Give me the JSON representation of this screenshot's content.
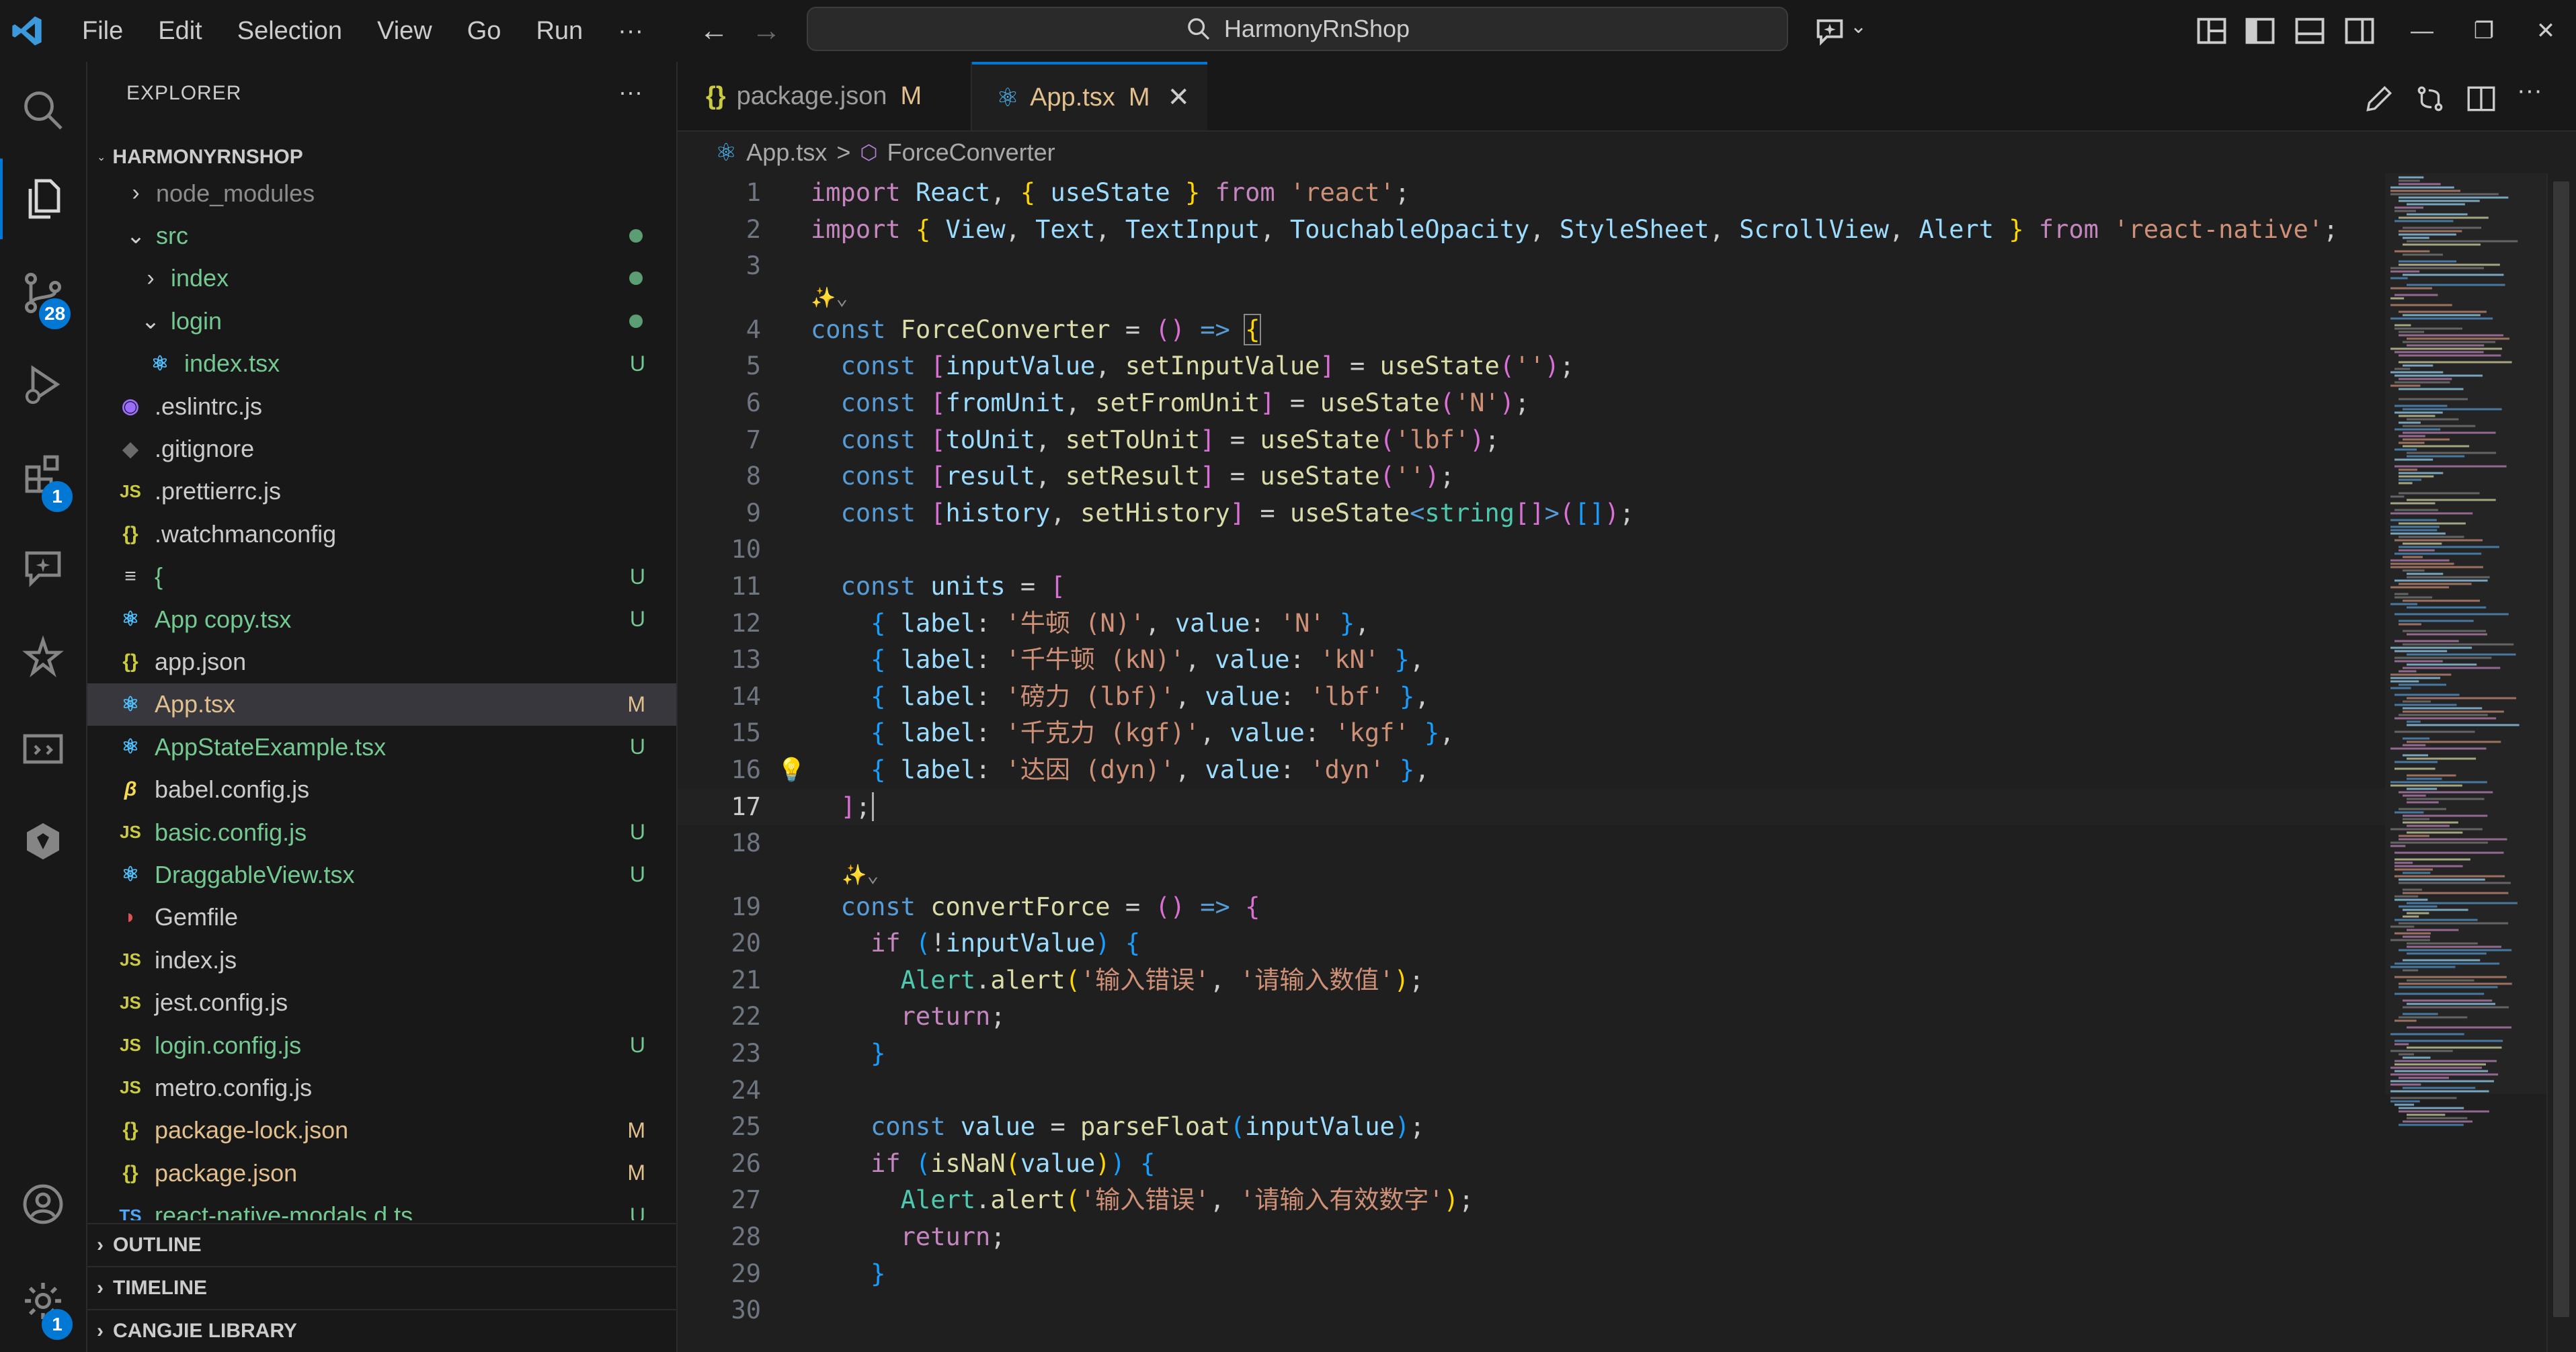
{
  "titlebar": {
    "menu": [
      "File",
      "Edit",
      "Selection",
      "View",
      "Go",
      "Run",
      "···"
    ],
    "search": "HarmonyRnShop"
  },
  "activity": {
    "scm_badge": "28",
    "extensions_badge": "1",
    "settings_badge": "1"
  },
  "sidebar": {
    "title": "EXPLORER",
    "more": "···",
    "root": "HARMONYRNSHOP",
    "items": [
      {
        "label": "node_modules",
        "icon": "chevron-right"
      },
      {
        "label": "src",
        "icon": "chevron-down"
      },
      {
        "label": "index",
        "icon": "chevron-right"
      },
      {
        "label": "login",
        "icon": "chevron-down"
      },
      {
        "label": "index.tsx",
        "icon": "react-icon",
        "status": "U"
      },
      {
        "label": ".eslintrc.js",
        "icon": "eslint-icon"
      },
      {
        "label": ".gitignore",
        "icon": "git-icon"
      },
      {
        "label": ".prettierrc.js",
        "icon": "js-icon",
        "icon_text": "JS"
      },
      {
        "label": ".watchmanconfig",
        "icon": "json-icon",
        "icon_text": "{}"
      },
      {
        "label": "{",
        "icon": "text-file-icon",
        "icon_text": "≡",
        "status": "U"
      },
      {
        "label": "App copy.tsx",
        "icon": "react-icon",
        "status": "U"
      },
      {
        "label": "app.json",
        "icon": "json-icon",
        "icon_text": "{}"
      },
      {
        "label": "App.tsx",
        "icon": "react-icon",
        "status": "M"
      },
      {
        "label": "AppStateExample.tsx",
        "icon": "react-icon",
        "status": "U"
      },
      {
        "label": "babel.config.js",
        "icon": "babel-icon",
        "icon_text": "β"
      },
      {
        "label": "basic.config.js",
        "icon": "js-icon",
        "icon_text": "JS",
        "status": "U"
      },
      {
        "label": "DraggableView.tsx",
        "icon": "react-icon",
        "status": "U"
      },
      {
        "label": "Gemfile",
        "icon": "ruby-icon"
      },
      {
        "label": "index.js",
        "icon": "js-icon",
        "icon_text": "JS"
      },
      {
        "label": "jest.config.js",
        "icon": "js-icon",
        "icon_text": "JS"
      },
      {
        "label": "login.config.js",
        "icon": "js-icon",
        "icon_text": "JS",
        "status": "U"
      },
      {
        "label": "metro.config.js",
        "icon": "js-icon",
        "icon_text": "JS"
      },
      {
        "label": "package-lock.json",
        "icon": "json-icon",
        "icon_text": "{}",
        "status": "M"
      },
      {
        "label": "package.json",
        "icon": "json-icon",
        "icon_text": "{}",
        "status": "M"
      },
      {
        "label": "react-native-modals.d.ts",
        "icon": "ts-icon",
        "icon_text": "TS",
        "status": "U"
      }
    ],
    "sections": [
      "OUTLINE",
      "TIMELINE",
      "CANGJIE LIBRARY"
    ]
  },
  "tabs": [
    {
      "label": "package.json",
      "icon_text": "{}",
      "status": "M"
    },
    {
      "label": "App.tsx",
      "status": "M",
      "close": "✕"
    }
  ],
  "breadcrumb": {
    "file": "App.tsx",
    "sep": ">",
    "symbol": "ForceConverter"
  },
  "editor": {
    "current_line": 17,
    "line_numbers": [
      "1",
      "2",
      "3",
      "4",
      "5",
      "6",
      "7",
      "8",
      "9",
      "10",
      "11",
      "12",
      "13",
      "14",
      "15",
      "16",
      "17",
      "18",
      "19",
      "20",
      "21",
      "22",
      "23",
      "24",
      "25",
      "26",
      "27",
      "28",
      "29",
      "30"
    ],
    "code": [
      "import React, { useState } from 'react';",
      "import { View, Text, TextInput, TouchableOpacity, StyleSheet, ScrollView, Alert } from 'react-native';",
      "",
      "const ForceConverter = () => {",
      "  const [inputValue, setInputValue] = useState('');",
      "  const [fromUnit, setFromUnit] = useState('N');",
      "  const [toUnit, setToUnit] = useState('lbf');",
      "  const [result, setResult] = useState('');",
      "  const [history, setHistory] = useState<string[]>([]);",
      "",
      "  const units = [",
      "    { label: '牛顿 (N)', value: 'N' },",
      "    { label: '千牛顿 (kN)', value: 'kN' },",
      "    { label: '磅力 (lbf)', value: 'lbf' },",
      "    { label: '千克力 (kgf)', value: 'kgf' },",
      "    { label: '达因 (dyn)', value: 'dyn' },",
      "  ];",
      "",
      "  const convertForce = () => {",
      "    if (!inputValue) {",
      "      Alert.alert('输入错误', '请输入数值');",
      "      return;",
      "    }",
      "",
      "    const value = parseFloat(inputValue);",
      "    if (isNaN(value)) {",
      "      Alert.alert('输入错误', '请输入有效数字');",
      "      return;",
      "    }",
      ""
    ]
  }
}
